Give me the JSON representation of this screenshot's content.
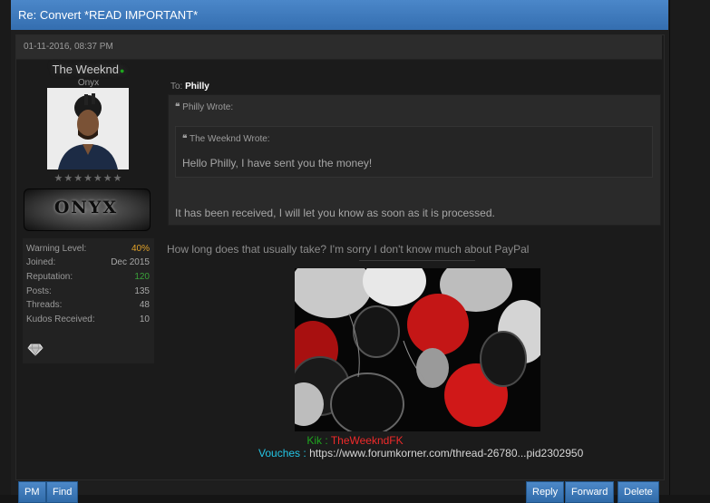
{
  "thread": {
    "title": "Re: Convert *READ IMPORTANT*"
  },
  "post": {
    "date": "01-11-2016, 08:37 PM",
    "to_label": "To:",
    "to_user": "Philly",
    "quote_outer_header": "Philly Wrote:",
    "quote_inner_header": "The Weeknd Wrote:",
    "quote_inner_text": "Hello Philly, I have sent you the money!",
    "quote_outer_text": "It has been received, I will let you know as soon as it is processed.",
    "body_text": "How long does that usually take? I'm sorry I don't know much about PayPal"
  },
  "user": {
    "name": "The Weeknd",
    "title": "Onyx",
    "stars": "★★★★★★★",
    "rank_banner": "ONYX",
    "stats": [
      {
        "label": "Warning Level:",
        "value": "40%"
      },
      {
        "label": "Joined:",
        "value": "Dec 2015"
      },
      {
        "label": "Reputation:",
        "value": "120"
      },
      {
        "label": "Posts:",
        "value": "135"
      },
      {
        "label": "Threads:",
        "value": "48"
      },
      {
        "label": "Kudos Received:",
        "value": "10"
      }
    ]
  },
  "signature": {
    "kik_label": "Kik :",
    "kik_value": "TheWeekndFK",
    "vouches_label": "Vouches :",
    "vouches_value": "https://www.forumkorner.com/thread-26780...pid2302950"
  },
  "buttons": {
    "pm": "PM",
    "find": "Find",
    "reply": "Reply",
    "forward": "Forward",
    "delete": "Delete"
  },
  "colors": {
    "accent_blue": "#3a77bb",
    "warning": "#e2a229",
    "reputation": "#3aa23a",
    "kik_label": "#1fa51f",
    "kik_value": "#ef2a2a",
    "vouches_label": "#24c4e4"
  },
  "icons": {
    "quote": "quote-icon",
    "online": "online-status-icon",
    "gem": "diamond-award-icon"
  }
}
